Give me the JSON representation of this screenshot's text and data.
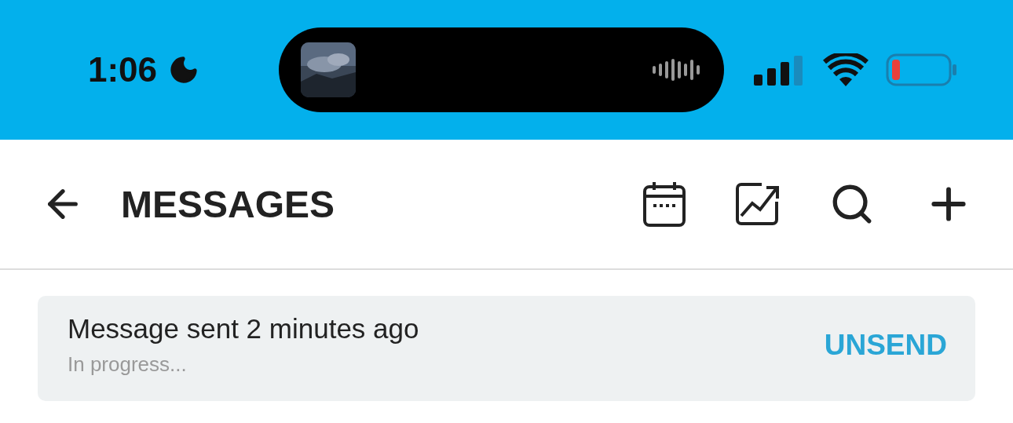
{
  "status_bar": {
    "time": "1:06"
  },
  "header": {
    "title": "MESSAGES"
  },
  "notice": {
    "text": "Message sent 2 minutes ago",
    "status": "In progress...",
    "action": "UNSEND"
  }
}
